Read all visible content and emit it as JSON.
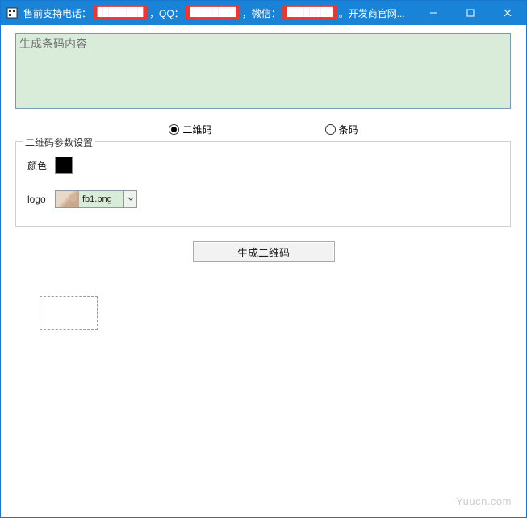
{
  "titlebar": {
    "prefix": "售前支持电话：",
    "phone_redacted": "████████",
    "qq_label": "，QQ：",
    "qq_redacted": "████████",
    "wechat_label": "，微信：",
    "wechat_redacted": "████████",
    "suffix": "。开发商官网..."
  },
  "input": {
    "placeholder": "生成条码内容"
  },
  "radios": {
    "qrcode": "二维码",
    "barcode": "条码",
    "selected": "qrcode"
  },
  "groupbox": {
    "legend": "二维码参数设置",
    "color_label": "颜色",
    "color_value": "#000000",
    "logo_label": "logo",
    "logo_filename": "fb1.png"
  },
  "buttons": {
    "generate": "生成二维码"
  },
  "watermark": "Yuucn.com"
}
